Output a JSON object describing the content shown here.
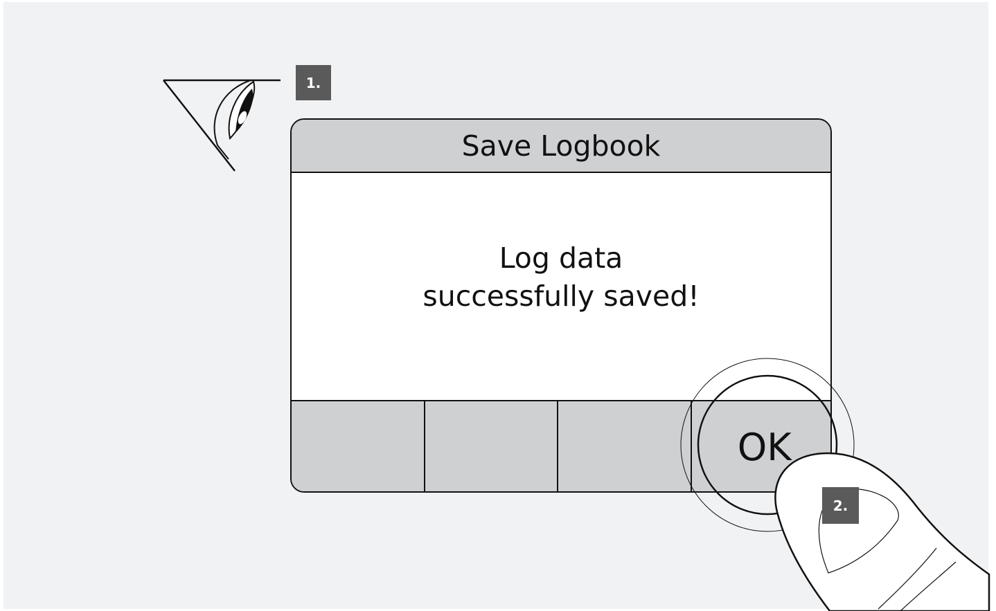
{
  "dialog": {
    "title": "Save Logbook",
    "message": "Log data successfully saved!"
  },
  "softkeys": [
    {
      "label": ""
    },
    {
      "label": ""
    },
    {
      "label": ""
    },
    {
      "label": "OK"
    }
  ],
  "steps": {
    "step1": "1.",
    "step2": "2."
  },
  "icons": {
    "eye": "eye-icon",
    "finger": "finger-press-icon",
    "press_ring": "press-indicator-icon"
  },
  "colors": {
    "background": "#f1f2f4",
    "header_fill": "#cfd0d2",
    "badge_fill": "#5a5a5b",
    "line": "#111111"
  }
}
